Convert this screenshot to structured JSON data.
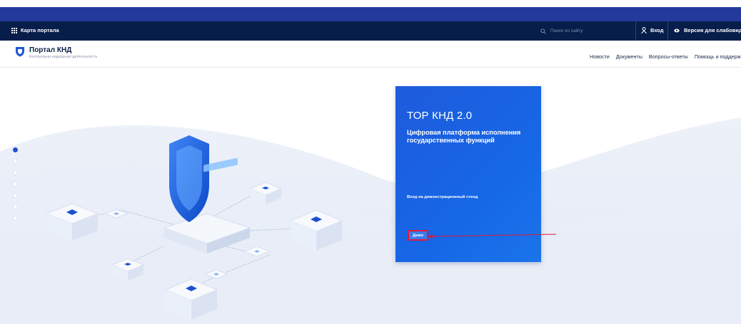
{
  "topbar": {
    "portal_map_label": "Карта портала",
    "search_placeholder": "Поиск по сайту",
    "login_label": "Вход",
    "version_label": "Версия для слабовидящих"
  },
  "header": {
    "logo_title": "Портал КНД",
    "logo_subtitle": "Контрольно-надзорная деятельность",
    "nav": [
      "Новости",
      "Документы",
      "Вопросы-ответы",
      "Помощь и поддержка"
    ]
  },
  "hero": {
    "card_title": "ТОР КНД 2.0",
    "card_subtitle": "Цифровая платформа исполнения государственных функций",
    "card_link": "Вход на демонстрационный стенд",
    "demo_button": "Демо",
    "slides": 7,
    "active_slide": 1
  },
  "colors": {
    "topbar_bg": "#071d4a",
    "band_bg": "#243a9a",
    "card_bg": "#1e5bdc",
    "highlight": "#e2183a"
  },
  "icons": [
    "grid-icon",
    "search-icon",
    "user-icon",
    "eye-icon",
    "shield-logo-icon",
    "shield-illustration"
  ]
}
